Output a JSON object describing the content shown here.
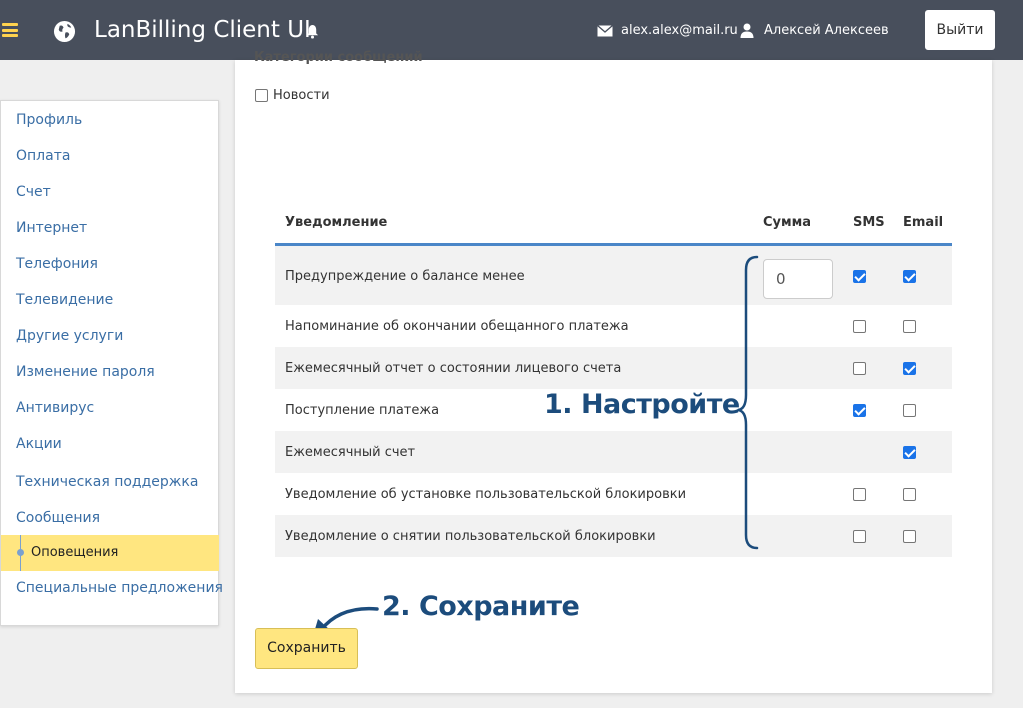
{
  "header": {
    "app_title": "LanBilling Client UI",
    "email": "alex.alex@mail.ru",
    "user_name": "Алексей Алексеев",
    "logout_label": "Выйти",
    "accent_color": "#ffd34e",
    "bg_color": "#484f5c"
  },
  "sidebar": {
    "items": [
      {
        "label": "Профиль"
      },
      {
        "label": "Оплата"
      },
      {
        "label": "Счет"
      },
      {
        "label": "Интернет"
      },
      {
        "label": "Телефония"
      },
      {
        "label": "Телевидение"
      },
      {
        "label": "Другие услуги"
      },
      {
        "label": "Изменение пароля"
      },
      {
        "label": "Антивирус"
      },
      {
        "label": "Акции"
      },
      {
        "label": "Техническая поддержка"
      },
      {
        "label": "Сообщения"
      },
      {
        "label": "Оповещения",
        "active": true
      },
      {
        "label": "Специальные предложения"
      }
    ],
    "active_color": "#ffe680",
    "link_color": "#3a6ea5"
  },
  "categories": {
    "title": "Категории сообщений",
    "items": [
      {
        "label": "Новости",
        "checked": false
      }
    ]
  },
  "table": {
    "columns": {
      "notification": "Уведомление",
      "sum": "Сумма",
      "sms": "SMS",
      "email": "Email"
    },
    "rows": [
      {
        "name": "Предупреждение о балансе менее",
        "sum": "0",
        "sms": true,
        "email": true
      },
      {
        "name": "Напоминание об окончании обещанного платежа",
        "sms": false,
        "email": false
      },
      {
        "name": "Ежемесячный отчет о состоянии лицевого счета",
        "sms": false,
        "email": true
      },
      {
        "name": "Поступление платежа",
        "sms": true,
        "email": false
      },
      {
        "name": "Ежемесячный счет",
        "sms": null,
        "email": true
      },
      {
        "name": "Уведомление об установке пользовательской блокировки",
        "sms": false,
        "email": false
      },
      {
        "name": "Уведомление о снятии пользовательской блокировки",
        "sms": false,
        "email": false
      }
    ]
  },
  "annotations": {
    "step1": "1. Настройте",
    "step2": "2. Сохраните",
    "color": "#1c4c7c"
  },
  "save_label": "Сохранить"
}
